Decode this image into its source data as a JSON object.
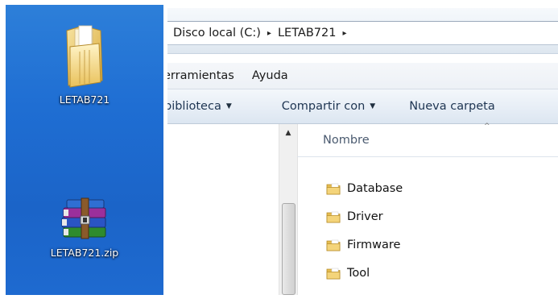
{
  "desktop": {
    "icons": [
      {
        "label": "LETAB721",
        "icon": "folder-icon"
      },
      {
        "label": "LETAB721.zip",
        "icon": "winrar-archive-icon"
      }
    ]
  },
  "explorer": {
    "address": {
      "crumbs": [
        "Disco local (C:)",
        "LETAB721"
      ],
      "separator": "▸"
    },
    "menu": [
      "erramientas",
      "Ayuda"
    ],
    "toolbar": {
      "library": "biblioteca",
      "share": "Compartir con",
      "new_folder": "Nueva carpeta",
      "caret": "▼"
    },
    "scrollbar_up": "▲",
    "column_header": "Nombre",
    "sort_indicator": "^",
    "files": [
      {
        "name": "Database",
        "icon": "folder-icon"
      },
      {
        "name": "Driver",
        "icon": "folder-icon"
      },
      {
        "name": "Firmware",
        "icon": "folder-icon"
      },
      {
        "name": "Tool",
        "icon": "folder-icon"
      }
    ]
  },
  "colors": {
    "desktop_blue": "#1f6ed3",
    "folder_yellow": "#e8c25a",
    "toolbar_text": "#1e3552"
  }
}
